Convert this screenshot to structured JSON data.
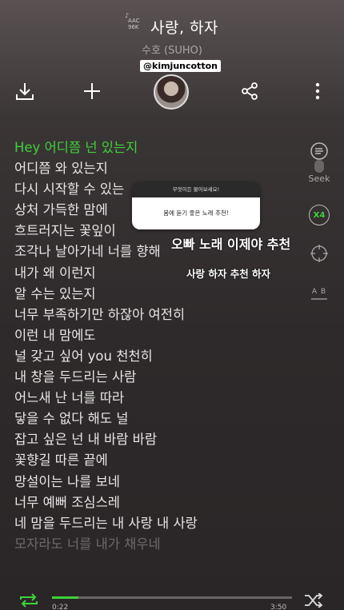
{
  "header": {
    "quality_line1": "AAC",
    "quality_line2": "96K",
    "song_title": "사랑, 하자",
    "artist": "수호 (SUHO)",
    "username": "@kimjuncotton"
  },
  "toolbar": {
    "download_icon": "download-icon",
    "add_icon": "plus-icon",
    "share_icon": "share-icon",
    "more_icon": "more-vertical-icon"
  },
  "lyrics": [
    "Hey 어디쯤 넌 있는지",
    "어디쯤 와 있는지",
    "다시 시작할 수 있는",
    "상처 가득한 맘에",
    "흐트러지는 꽃잎이",
    "조각나 날아가네 너를 향해",
    "내가 왜 이런지",
    "알 수는 있는지",
    "너무 부족하기만 하잖아 여전히",
    "이런 내 맘에도",
    "널 갖고 싶어 you 천천히",
    "내 창을 두드리는 사람",
    "어느새 난 너를 따라",
    "닿을 수 없다 해도 널",
    "잡고 싶은 넌 내 바람 바람",
    "꽃향길 따른 끝에",
    "망설이는 나를 보네",
    "너무 예뻐 조심스레",
    "네 맘을 두드리는 내 사랑 내 사랑",
    "모자라도 너를 내가 채우네"
  ],
  "side_controls": {
    "seek_label": "Seek",
    "speed_label": "X4",
    "ab_label": "A B"
  },
  "story": {
    "question_prompt": "무엇이든 물어보세요!",
    "question_answer": "봄에 듣기 좋은 노래 추천!",
    "text1": "오빠 노래 이제야 추천",
    "text2": "사랑 하자 추천 하자"
  },
  "player": {
    "current_time": "0:22",
    "total_time": "3:50",
    "progress": 0.11,
    "accent_color": "#3fd13a"
  }
}
